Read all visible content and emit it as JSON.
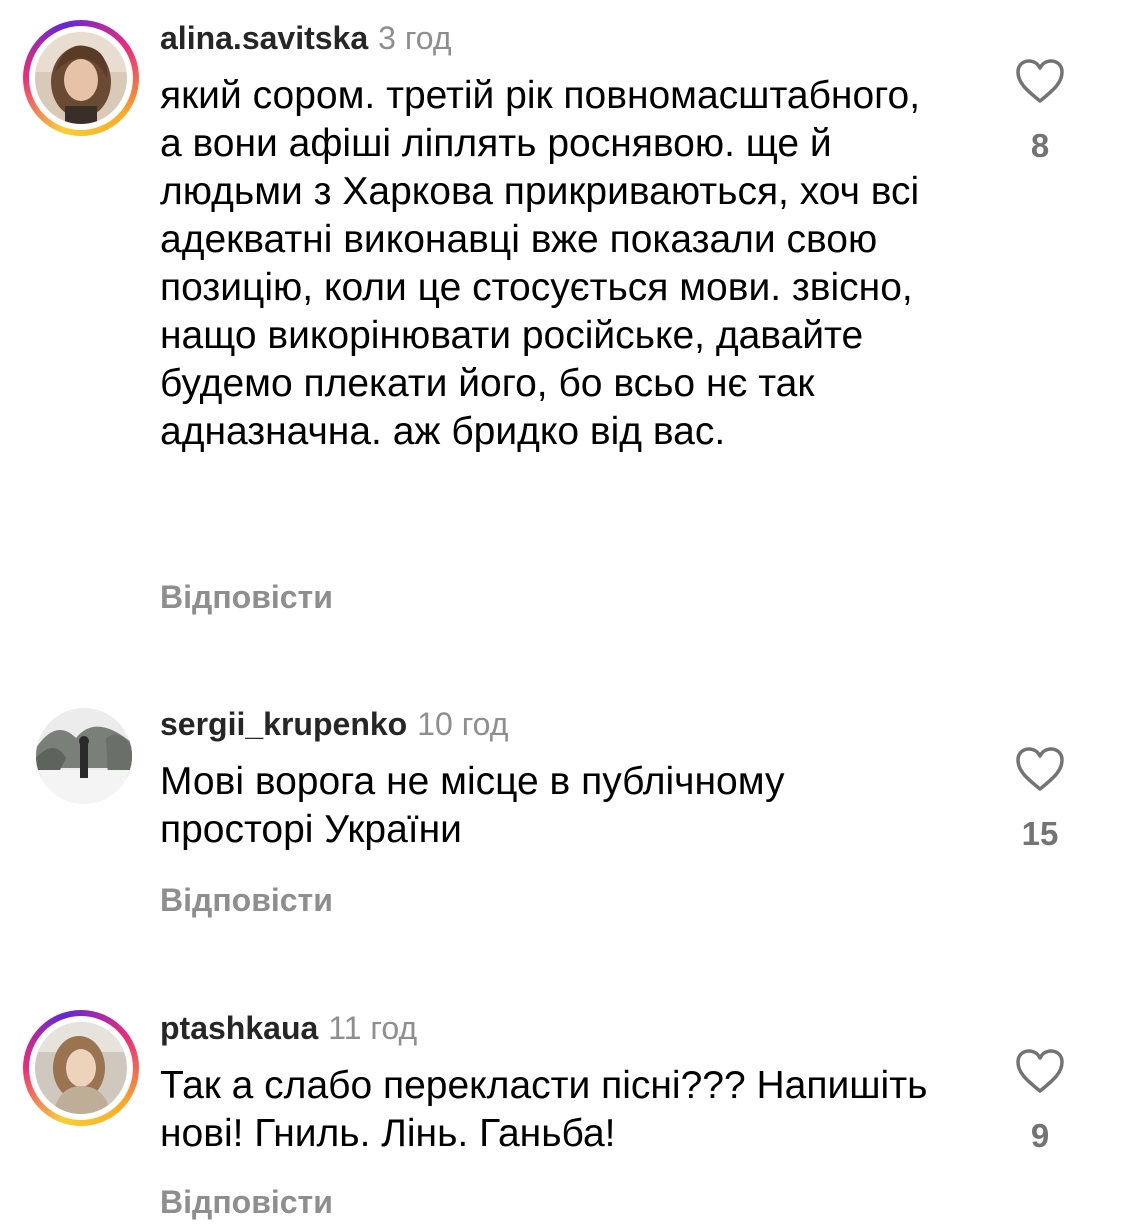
{
  "comments": [
    {
      "username": "alina.savitska",
      "time": "3 год",
      "text": "який сором. третій рік повномасштабного, а вони афіші ліплять роснявою. ще й людьми з Харкова прикриваються, хоч всі адекватні виконавці вже показали свою позицію, коли це стосується мови. звісно, нащо викорінювати російське, давайте будемо плекати його, бо всьо нє так адназначна. аж бридко від вас.",
      "likes": "8",
      "reply_label": "Відповісти",
      "has_story": true
    },
    {
      "username": "sergii_krupenko",
      "time": "10 год",
      "text": "Мові ворога не місце в публічному просторі України",
      "likes": "15",
      "reply_label": "Відповісти",
      "has_story": false
    },
    {
      "username": "ptashkaua",
      "time": "11 год",
      "text": "Так а слабо перекласти пісні??? Напишіть нові! Гниль. Лінь. Ганьба!",
      "likes": "9",
      "reply_label": "Відповісти",
      "has_story": true
    }
  ],
  "icons": {
    "like": "heart-outline-icon"
  },
  "colors": {
    "username": "#262626",
    "meta_gray": "#8e8e8e",
    "like_count": "#737373",
    "story_ring": [
      "#f9ce34",
      "#ee2a7b",
      "#6228d7"
    ]
  }
}
